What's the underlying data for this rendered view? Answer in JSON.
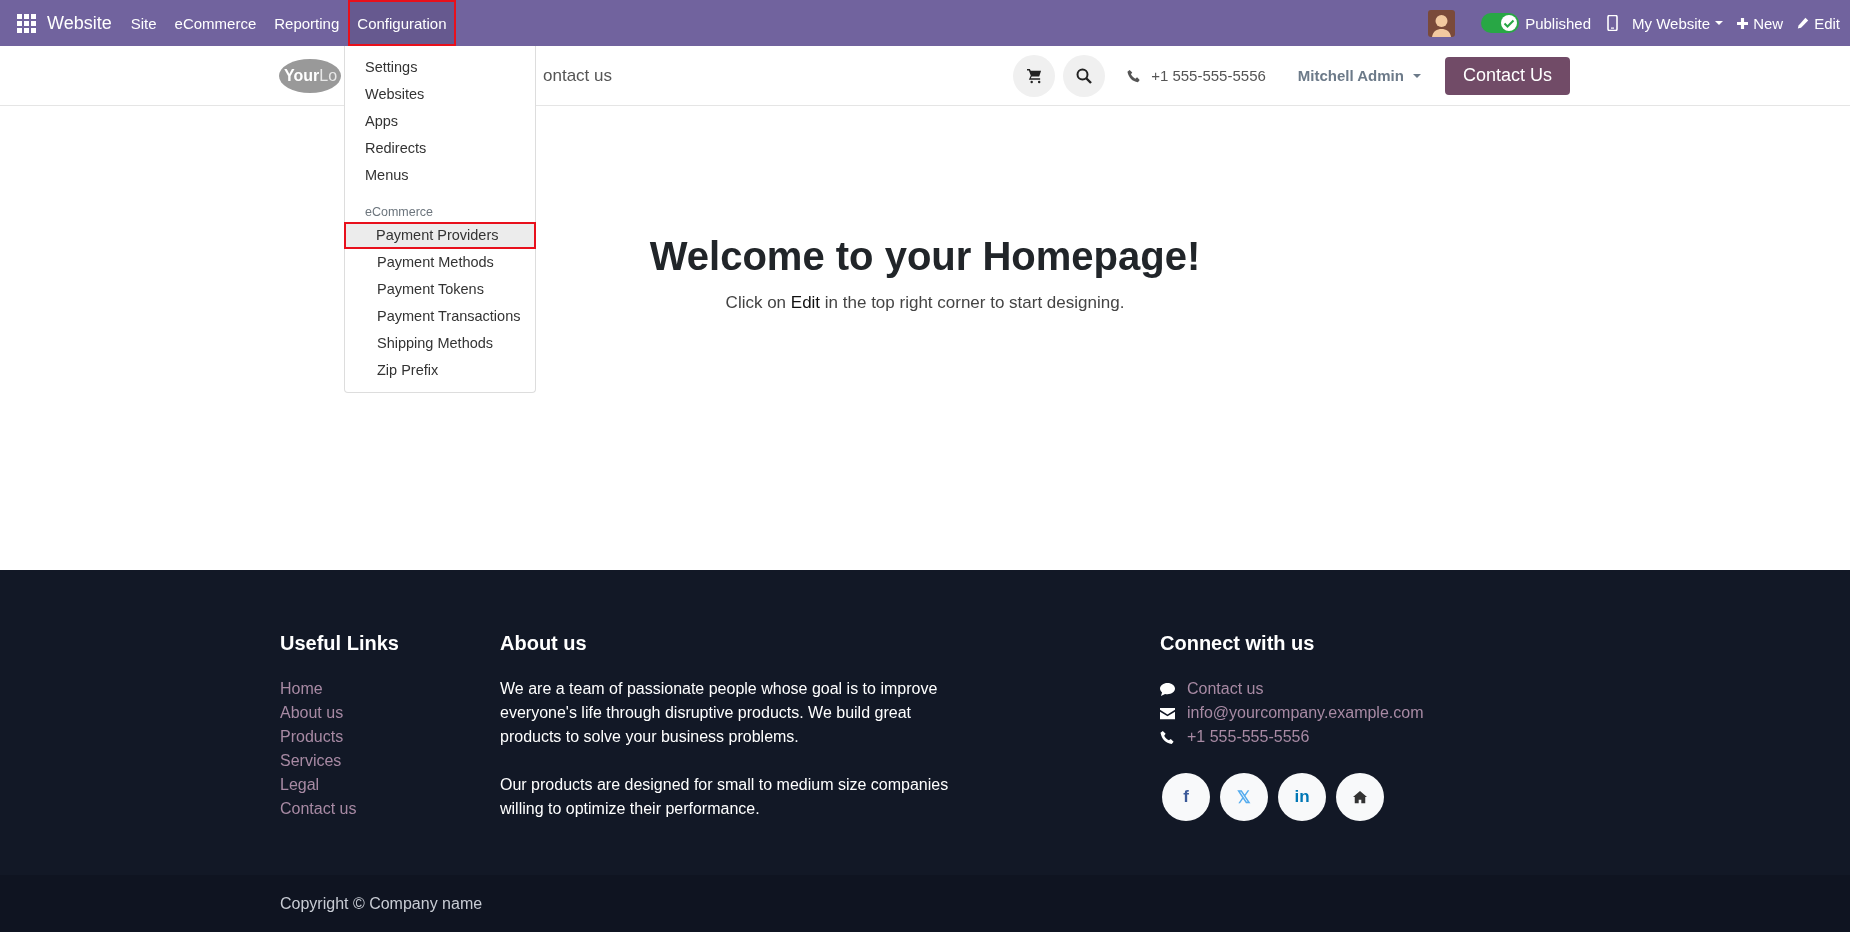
{
  "topbar": {
    "app_name": "Website",
    "menus": [
      {
        "label": "Site",
        "selected": false,
        "highlighted": false
      },
      {
        "label": "eCommerce",
        "selected": false,
        "highlighted": false
      },
      {
        "label": "Reporting",
        "selected": false,
        "highlighted": false
      },
      {
        "label": "Configuration",
        "selected": true,
        "highlighted": true
      }
    ],
    "published": {
      "label": "Published",
      "on": true
    },
    "site_selector": "My Website",
    "new_button": "New",
    "edit_button": "Edit"
  },
  "dropdown": {
    "sections": [
      {
        "items": [
          {
            "label": "Settings",
            "selected": false,
            "highlighted": false
          },
          {
            "label": "Websites",
            "selected": false,
            "highlighted": false
          },
          {
            "label": "Apps",
            "selected": false,
            "highlighted": false
          },
          {
            "label": "Redirects",
            "selected": false,
            "highlighted": false
          },
          {
            "label": "Menus",
            "selected": false,
            "highlighted": false
          }
        ]
      },
      {
        "title": "eCommerce",
        "items": [
          {
            "label": "Payment Providers",
            "selected": true,
            "highlighted": true
          },
          {
            "label": "Payment Methods",
            "selected": false,
            "highlighted": false
          },
          {
            "label": "Payment Tokens",
            "selected": false,
            "highlighted": false
          },
          {
            "label": "Payment Transactions",
            "selected": false,
            "highlighted": false
          },
          {
            "label": "Shipping Methods",
            "selected": false,
            "highlighted": false
          },
          {
            "label": "Zip Prefix",
            "selected": false,
            "highlighted": false
          }
        ]
      }
    ]
  },
  "header": {
    "logo": {
      "bold": "Your",
      "light": "Lo"
    },
    "nav_link": "ontact us",
    "phone": "+1 555-555-5556",
    "user": "Mitchell Admin",
    "contact_button": "Contact Us"
  },
  "hero": {
    "title": "Welcome to your Homepage!",
    "subtitle": "Click on **Edit** in the top right corner to start designing."
  },
  "footer": {
    "useful_links": {
      "title": "Useful Links",
      "links": [
        "Home",
        "About us",
        "Products",
        "Services",
        "Legal",
        "Contact us"
      ]
    },
    "about": {
      "title": "About us",
      "paragraphs": [
        "We are a team of passionate people whose goal is to improve everyone's life through disruptive products. We build great products to solve your business problems.",
        "Our products are designed for small to medium size companies willing to optimize their performance."
      ]
    },
    "connect": {
      "title": "Connect with us",
      "items": [
        {
          "kind": "chat",
          "label": "Contact us"
        },
        {
          "kind": "email",
          "label": "info@yourcompany.example.com"
        },
        {
          "kind": "phone",
          "label": "+1 555-555-5556"
        }
      ],
      "social": [
        {
          "kind": "facebook",
          "glyph": "f"
        },
        {
          "kind": "x",
          "glyph": "𝕏"
        },
        {
          "kind": "linkedin",
          "glyph": "in"
        },
        {
          "kind": "home"
        }
      ]
    },
    "copyright": "Copyright © Company name"
  }
}
